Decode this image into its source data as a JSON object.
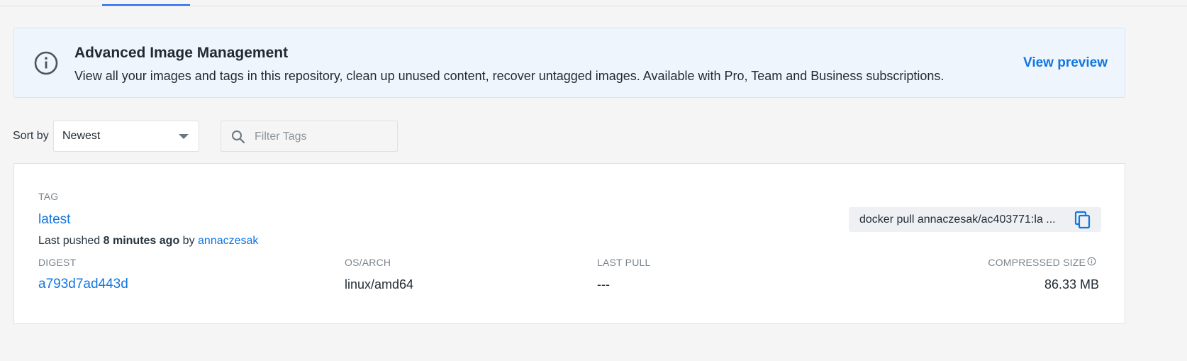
{
  "banner": {
    "title": "Advanced Image Management",
    "description": "View all your images and tags in this repository, clean up unused content, recover untagged images. Available with Pro, Team and Business subscriptions.",
    "action_label": "View preview",
    "icon": "info-icon"
  },
  "controls": {
    "sort_label": "Sort by",
    "sort_selected": "Newest",
    "filter_placeholder": "Filter Tags",
    "filter_value": ""
  },
  "tag": {
    "section_label": "TAG",
    "name": "latest",
    "pushed_prefix": "Last pushed",
    "pushed_when": "8 minutes ago",
    "pushed_by_word": "by",
    "pushed_by_user": "annaczesak",
    "pull_command": "docker pull annaczesak/ac403771:la ...",
    "columns": {
      "digest_label": "DIGEST",
      "os_arch_label": "OS/ARCH",
      "last_pull_label": "LAST PULL",
      "compressed_size_label": "COMPRESSED SIZE"
    },
    "values": {
      "digest": "a793d7ad443d",
      "os_arch": "linux/amd64",
      "last_pull": "---",
      "compressed_size": "86.33 MB"
    }
  },
  "colors": {
    "accent": "#1176e1",
    "banner_bg": "#eff5fc",
    "page_bg": "#f5f5f5"
  }
}
